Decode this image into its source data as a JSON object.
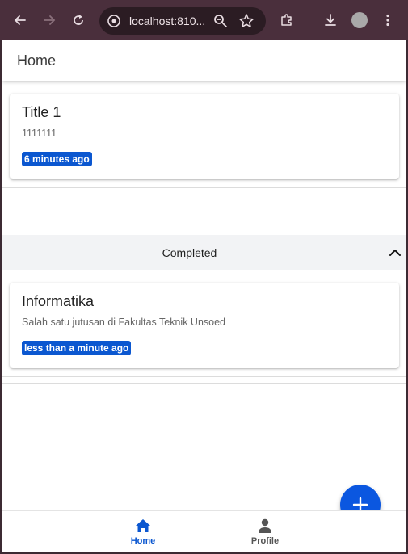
{
  "browser": {
    "url": "localhost:810...",
    "icons": {
      "back": "arrow-left-icon",
      "forward": "arrow-right-icon",
      "reload": "reload-icon",
      "site_info": "site-info-icon",
      "zoom": "zoom-icon",
      "bookmark": "star-icon",
      "extensions": "puzzle-icon",
      "downloads": "download-icon",
      "profile": "avatar",
      "menu": "kebab-menu-icon"
    }
  },
  "app_bar": {
    "title": "Home"
  },
  "todos": [
    {
      "title": "Title 1",
      "description": "1111111",
      "time": "6 minutes ago"
    }
  ],
  "completed_section": {
    "label": "Completed",
    "expanded": true,
    "items": [
      {
        "title": "Informatika",
        "description": "Salah satu jutusan di Fakultas Teknik Unsoed",
        "time": "less than a minute ago"
      }
    ]
  },
  "fab": {
    "icon": "plus-icon"
  },
  "bottom_nav": {
    "items": [
      {
        "label": "Home",
        "icon": "home-icon",
        "active": true
      },
      {
        "label": "Profile",
        "icon": "person-icon",
        "active": false
      }
    ]
  },
  "colors": {
    "accent": "#0b57d0",
    "browser_frame": "#4a2f3c",
    "section_bg": "#f2f3f5"
  }
}
